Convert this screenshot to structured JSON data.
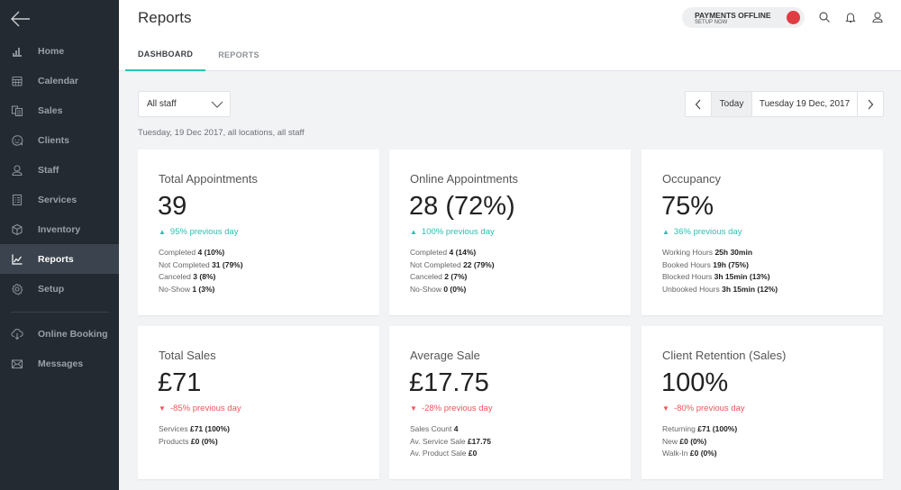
{
  "sidebar": {
    "back_icon": "arrow-left-icon",
    "items": [
      {
        "label": "Home",
        "icon": "bar-chart-icon",
        "active": false
      },
      {
        "label": "Calendar",
        "icon": "calendar-icon",
        "active": false
      },
      {
        "label": "Sales",
        "icon": "sales-icon",
        "active": false
      },
      {
        "label": "Clients",
        "icon": "smiley-chat-icon",
        "active": false
      },
      {
        "label": "Staff",
        "icon": "person-icon",
        "active": false
      },
      {
        "label": "Services",
        "icon": "list-icon",
        "active": false
      },
      {
        "label": "Inventory",
        "icon": "box-icon",
        "active": false
      },
      {
        "label": "Reports",
        "icon": "line-chart-icon",
        "active": true
      },
      {
        "label": "Setup",
        "icon": "gear-icon",
        "active": false
      }
    ],
    "secondary": [
      {
        "label": "Online Booking",
        "icon": "cloud-download-icon"
      },
      {
        "label": "Messages",
        "icon": "envelope-icon"
      }
    ]
  },
  "header": {
    "title": "Reports",
    "tabs": [
      {
        "label": "DASHBOARD",
        "active": true
      },
      {
        "label": "REPORTS",
        "active": false
      }
    ],
    "payments": {
      "title": "PAYMENTS OFFLINE",
      "subtitle": "SETUP NOW",
      "status_color": "#e03c41"
    },
    "icons": [
      "search-icon",
      "bell-icon",
      "user-icon"
    ]
  },
  "filters": {
    "staff_select": "All staff",
    "subtitle": "Tuesday, 19 Dec 2017, all locations, all staff",
    "today_label": "Today",
    "date_label": "Tuesday 19 Dec, 2017"
  },
  "colors": {
    "accent": "#28c7b4",
    "up": "#2bbfae",
    "down": "#f2545b",
    "sidebar": "#242a31"
  },
  "cards": [
    {
      "title": "Total Appointments",
      "value": "39",
      "trend": "up",
      "trend_text": "95% previous day",
      "details": [
        {
          "label": "Completed",
          "value": "4 (10%)"
        },
        {
          "label": "Not Completed",
          "value": "31 (79%)"
        },
        {
          "label": "Canceled",
          "value": "3 (8%)"
        },
        {
          "label": "No-Show",
          "value": "1 (3%)"
        }
      ]
    },
    {
      "title": "Online Appointments",
      "value": "28 (72%)",
      "trend": "up",
      "trend_text": "100% previous day",
      "details": [
        {
          "label": "Completed",
          "value": "4 (14%)"
        },
        {
          "label": "Not Completed",
          "value": "22 (79%)"
        },
        {
          "label": "Canceled",
          "value": "2 (7%)"
        },
        {
          "label": "No-Show",
          "value": "0 (0%)"
        }
      ]
    },
    {
      "title": "Occupancy",
      "value": "75%",
      "trend": "up",
      "trend_text": "36% previous day",
      "details": [
        {
          "label": "Working Hours",
          "value": "25h 30min"
        },
        {
          "label": "Booked Hours",
          "value": "19h (75%)"
        },
        {
          "label": "Blocked Hours",
          "value": "3h 15min (13%)"
        },
        {
          "label": "Unbooked Hours",
          "value": "3h 15min (12%)"
        }
      ]
    },
    {
      "title": "Total Sales",
      "value": "£71",
      "trend": "down",
      "trend_text": "-85% previous day",
      "details": [
        {
          "label": "Services",
          "value": "£71 (100%)"
        },
        {
          "label": "Products",
          "value": "£0 (0%)"
        }
      ]
    },
    {
      "title": "Average Sale",
      "value": "£17.75",
      "trend": "down",
      "trend_text": "-28% previous day",
      "details": [
        {
          "label": "Sales Count",
          "value": "4"
        },
        {
          "label": "Av. Service Sale",
          "value": "£17.75"
        },
        {
          "label": "Av. Product Sale",
          "value": "£0"
        }
      ]
    },
    {
      "title": "Client Retention (Sales)",
      "value": "100%",
      "trend": "down",
      "trend_text": "-80% previous day",
      "details": [
        {
          "label": "Returning",
          "value": "£71 (100%)"
        },
        {
          "label": "New",
          "value": "£0 (0%)"
        },
        {
          "label": "Walk-In",
          "value": "£0 (0%)"
        }
      ]
    }
  ]
}
